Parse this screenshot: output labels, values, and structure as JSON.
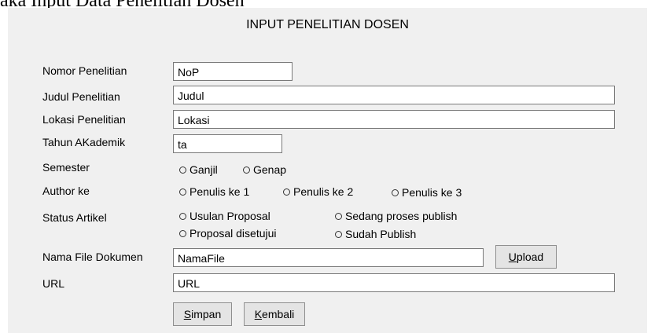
{
  "caption": "aka Input Data Penelitian Dosen",
  "form": {
    "title": "INPUT PENELITIAN DOSEN",
    "labels": {
      "nomor": "Nomor Penelitian",
      "judul": "Judul Penelitian",
      "lokasi": "Lokasi Penelitian",
      "tahun": "Tahun AKademik",
      "semester": "Semester",
      "author": "Author ke",
      "status": "Status Artikel",
      "file": "Nama File Dokumen",
      "url": "URL"
    },
    "values": {
      "nomor": "NoP",
      "judul": "Judul",
      "lokasi": "Lokasi",
      "tahun": "ta",
      "file": "NamaFile",
      "url": "URL"
    },
    "semester_options": [
      "Ganjil",
      "Genap"
    ],
    "author_options": [
      "Penulis ke 1",
      "Penulis ke 2",
      "Penulis ke 3"
    ],
    "status_options": [
      "Usulan Proposal",
      "Sedang proses publish",
      "Proposal disetujui",
      "Sudah Publish"
    ],
    "buttons": {
      "upload_first": "U",
      "upload_rest": "pload",
      "simpan_first": "S",
      "simpan_rest": "impan",
      "kembali_first": "K",
      "kembali_rest": "embali"
    }
  }
}
